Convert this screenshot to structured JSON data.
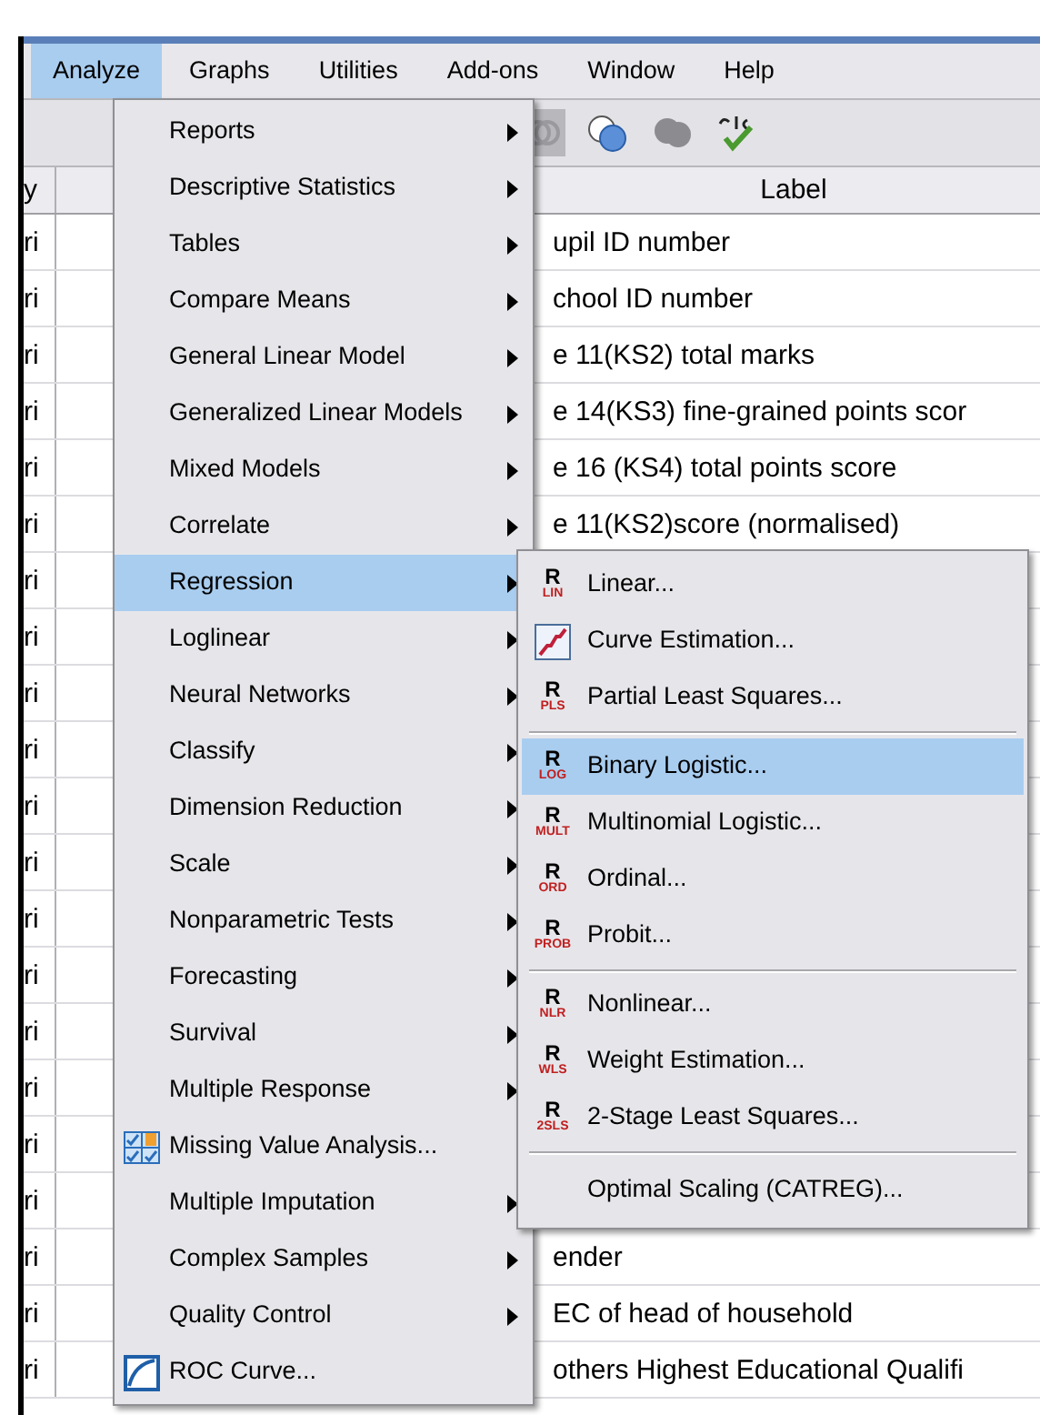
{
  "menubar": [
    {
      "label": "Analyze",
      "selected": true
    },
    {
      "label": "Graphs",
      "selected": false
    },
    {
      "label": "Utilities",
      "selected": false
    },
    {
      "label": "Add-ons",
      "selected": false
    },
    {
      "label": "Window",
      "selected": false
    },
    {
      "label": "Help",
      "selected": false
    }
  ],
  "table": {
    "columns": [
      "y",
      "Label"
    ],
    "rows": [
      {
        "column_1": "ri",
        "label": "upil ID number"
      },
      {
        "column_1": "ri",
        "label": "chool ID number"
      },
      {
        "column_1": "ri",
        "label": "e 11(KS2) total marks"
      },
      {
        "column_1": "ri",
        "label": "e 14(KS3) fine-grained points scor"
      },
      {
        "column_1": "ri",
        "label": "e 16 (KS4) total points score"
      },
      {
        "column_1": "ri",
        "label": "e 11(KS2)score (normalised)"
      },
      {
        "column_1": "ri",
        "label": ""
      },
      {
        "column_1": "ri",
        "label": ""
      },
      {
        "column_1": "ri",
        "label": ""
      },
      {
        "column_1": "ri",
        "label": ""
      },
      {
        "column_1": "ri",
        "label": ""
      },
      {
        "column_1": "ri",
        "label": ""
      },
      {
        "column_1": "ri",
        "label": ""
      },
      {
        "column_1": "ri",
        "label": ""
      },
      {
        "column_1": "ri",
        "label": ""
      },
      {
        "column_1": "ri",
        "label": ""
      },
      {
        "column_1": "ri",
        "label": ""
      },
      {
        "column_1": "ri",
        "label": ""
      },
      {
        "column_1": "ri",
        "label": "ender"
      },
      {
        "column_1": "ri",
        "label": "EC of head of household"
      },
      {
        "column_1": "ri",
        "label": "others Highest Educational Qualifi"
      }
    ]
  },
  "analyze_menu": [
    {
      "label": "Reports",
      "kind": "submenu",
      "selected": false
    },
    {
      "label": "Descriptive Statistics",
      "kind": "submenu",
      "selected": false
    },
    {
      "label": "Tables",
      "kind": "submenu",
      "selected": false
    },
    {
      "label": "Compare Means",
      "kind": "submenu",
      "selected": false
    },
    {
      "label": "General Linear Model",
      "kind": "submenu",
      "selected": false
    },
    {
      "label": "Generalized Linear Models",
      "kind": "submenu",
      "selected": false
    },
    {
      "label": "Mixed Models",
      "kind": "submenu",
      "selected": false
    },
    {
      "label": "Correlate",
      "kind": "submenu",
      "selected": false
    },
    {
      "label": "Regression",
      "kind": "submenu",
      "selected": true
    },
    {
      "label": "Loglinear",
      "kind": "submenu",
      "selected": false
    },
    {
      "label": "Neural Networks",
      "kind": "submenu",
      "selected": false
    },
    {
      "label": "Classify",
      "kind": "submenu",
      "selected": false
    },
    {
      "label": "Dimension Reduction",
      "kind": "submenu",
      "selected": false
    },
    {
      "label": "Scale",
      "kind": "submenu",
      "selected": false
    },
    {
      "label": "Nonparametric Tests",
      "kind": "submenu",
      "selected": false
    },
    {
      "label": "Forecasting",
      "kind": "submenu",
      "selected": false
    },
    {
      "label": "Survival",
      "kind": "submenu",
      "selected": false
    },
    {
      "label": "Multiple Response",
      "kind": "submenu",
      "selected": false
    },
    {
      "label": "Missing Value Analysis...",
      "kind": "grid",
      "selected": false
    },
    {
      "label": "Multiple Imputation",
      "kind": "submenu",
      "selected": false
    },
    {
      "label": "Complex Samples",
      "kind": "submenu",
      "selected": false
    },
    {
      "label": "Quality Control",
      "kind": "submenu",
      "selected": false
    },
    {
      "label": "ROC Curve...",
      "kind": "roc",
      "selected": false
    }
  ],
  "regression_menu": [
    {
      "label": "Linear...",
      "kind": "r",
      "icon_letter": "R",
      "icon_code": "LIN",
      "selected": false
    },
    {
      "label": "Curve Estimation...",
      "kind": "curve",
      "selected": false
    },
    {
      "label": "Partial Least Squares...",
      "kind": "r",
      "icon_letter": "R",
      "icon_code": "PLS",
      "selected": false
    },
    {
      "kind": "separator"
    },
    {
      "label": "Binary Logistic...",
      "kind": "r",
      "icon_letter": "R",
      "icon_code": "LOG",
      "selected": true
    },
    {
      "label": "Multinomial Logistic...",
      "kind": "r",
      "icon_letter": "R",
      "icon_code": "MULT",
      "selected": false
    },
    {
      "label": "Ordinal...",
      "kind": "r",
      "icon_letter": "R",
      "icon_code": "ORD",
      "selected": false
    },
    {
      "label": "Probit...",
      "kind": "r",
      "icon_letter": "R",
      "icon_code": "PROB",
      "selected": false
    },
    {
      "kind": "separator"
    },
    {
      "label": "Nonlinear...",
      "kind": "r",
      "icon_letter": "R",
      "icon_code": "NLR",
      "selected": false
    },
    {
      "label": "Weight Estimation...",
      "kind": "r",
      "icon_letter": "R",
      "icon_code": "WLS",
      "selected": false
    },
    {
      "label": "2-Stage Least Squares...",
      "kind": "r",
      "icon_letter": "R",
      "icon_code": "2SLS",
      "selected": false
    },
    {
      "kind": "separator"
    },
    {
      "label": "Optimal Scaling (CATREG)...",
      "kind": "plain",
      "selected": false
    }
  ]
}
